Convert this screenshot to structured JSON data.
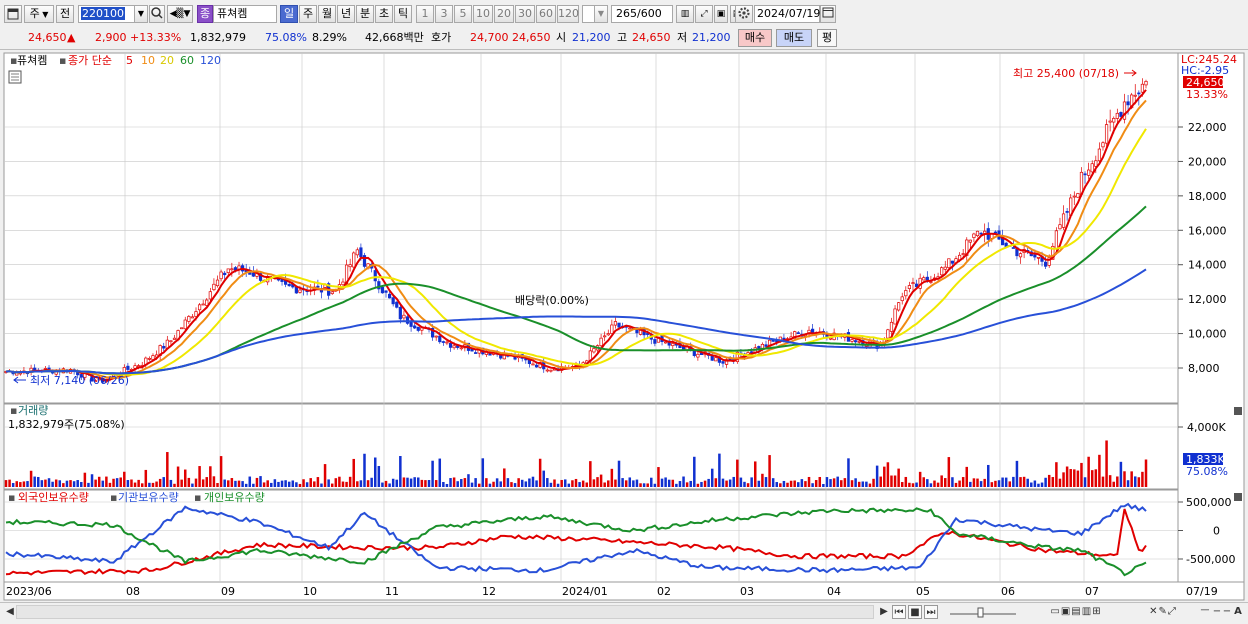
{
  "toolbar": {
    "period_label": "주",
    "prev_label": "전",
    "stock_code": "220100",
    "group_badge": "종",
    "stock_name": "퓨쳐켐",
    "intervals": [
      "일",
      "주",
      "월",
      "년",
      "분",
      "초",
      "틱"
    ],
    "active_interval": "일",
    "minute_options": [
      "1",
      "3",
      "5",
      "10",
      "20",
      "30",
      "60",
      "120"
    ],
    "count": "265",
    "count_total": "/600",
    "date": "2024/07/19"
  },
  "info": {
    "price": "24,650",
    "change_arrow": "▲",
    "change": "2,900",
    "change_pct": "+13.33%",
    "volume": "1,832,979",
    "volume_ratio": "75.08%",
    "turnover": "8.29%",
    "amount": "42,668백만",
    "ask_label": "호가",
    "ask": "24,700",
    "bid": "24,650",
    "open_label": "시",
    "open": "21,200",
    "high_label": "고",
    "high": "24,650",
    "low_label": "저",
    "low": "21,200",
    "buy_label": "매수",
    "sell_label": "매도",
    "eval_label": "평"
  },
  "price_panel": {
    "name_label": "퓨쳐켐",
    "ma_label": "종가 단순",
    "ma_periods": [
      "5",
      "10",
      "20",
      "60",
      "120"
    ],
    "ma_colors": [
      "#e00000",
      "#f08c14",
      "#f0e800",
      "#1a8f2a",
      "#2850d8"
    ],
    "lc_label": "LC:245.24",
    "hc_label": "HC:-2.95",
    "last_price_tag": "24,650",
    "last_pct_tag": "13.33%",
    "high_annotation": "최고 25,400 (07/18)",
    "low_annotation": "최저 7,140 (06/26)",
    "dividend_annotation": "배당락(0.00%)",
    "y_ticks": [
      "22,000",
      "20,000",
      "18,000",
      "16,000",
      "14,000",
      "12,000",
      "10,000",
      "8,000"
    ]
  },
  "volume_panel": {
    "title": "거래량",
    "subtitle": "1,832,979주(75.08%)",
    "y_tick": "4,000K",
    "last_tag": "1,833K",
    "last_pct": "75.08%"
  },
  "holding_panel": {
    "legend": [
      "외국인보유수량",
      "기관보유수량",
      "개인보유수량"
    ],
    "legend_colors": [
      "#e00000",
      "#2850d8",
      "#1a8f2a"
    ],
    "y_ticks": [
      "500,000",
      "0",
      "-500,000"
    ]
  },
  "x_axis": {
    "labels": [
      "2023/06",
      "08",
      "09",
      "10",
      "11",
      "12",
      "2024/01",
      "02",
      "03",
      "04",
      "05",
      "06",
      "07"
    ],
    "last_date": "07/19"
  },
  "colors": {
    "up": "#e00000",
    "down": "#1030d0",
    "grid": "#c8c8c8",
    "background": "#ffffff"
  }
}
